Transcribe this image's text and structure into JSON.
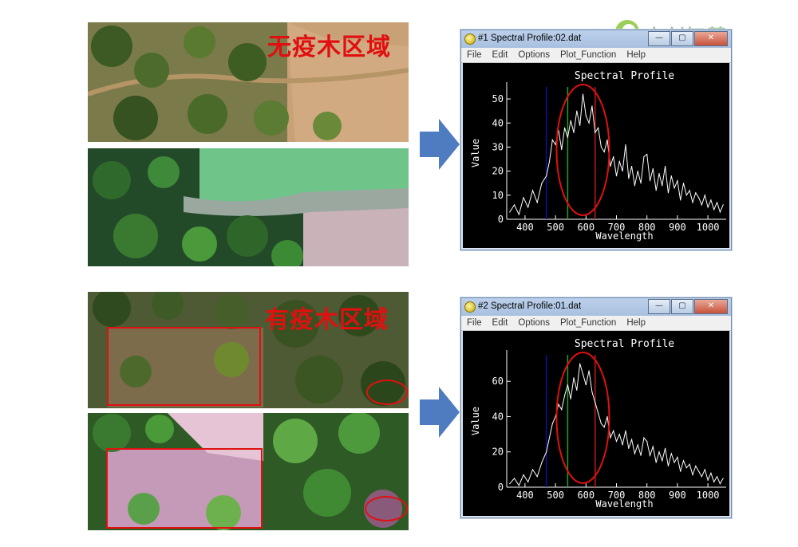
{
  "logo": {
    "text": "高创智慧"
  },
  "top": {
    "region_label": "无疫木区域",
    "window": {
      "title": "#1 Spectral Profile:02.dat",
      "menu": [
        "File",
        "Edit",
        "Options",
        "Plot_Function",
        "Help"
      ],
      "buttons": [
        "—",
        "▢",
        "✕"
      ]
    }
  },
  "bottom": {
    "region_label": "有疫木区域",
    "window": {
      "title": "#2 Spectral Profile:01.dat",
      "menu": [
        "File",
        "Edit",
        "Options",
        "Plot_Function",
        "Help"
      ],
      "buttons": [
        "—",
        "▢",
        "✕"
      ]
    }
  },
  "colors": {
    "annotation_red": "#e01010",
    "arrow_blue": "#4f7cc0",
    "line_blue": "#1010a0",
    "line_green": "#20a020",
    "line_red": "#c01818",
    "series": "#ffffff"
  },
  "chart_data": [
    {
      "type": "line",
      "title": "Spectral Profile",
      "xlabel": "Wavelength",
      "ylabel": "Value",
      "xlim": [
        340,
        1060
      ],
      "ylim": [
        0,
        55
      ],
      "xticks": [
        "400",
        "500",
        "600",
        "700",
        "800",
        "900",
        "1000"
      ],
      "yticks": [
        "0",
        "10",
        "20",
        "30",
        "40",
        "50"
      ],
      "vlines": [
        {
          "x": 470,
          "color": "#1010a0"
        },
        {
          "x": 540,
          "color": "#20a020"
        },
        {
          "x": 630,
          "color": "#c01818"
        }
      ],
      "ellipse_x_center": 590,
      "series": [
        {
          "x": [
            350,
            365,
            380,
            395,
            410,
            425,
            440,
            455,
            470,
            480,
            490,
            500,
            510,
            520,
            530,
            540,
            550,
            560,
            570,
            580,
            590,
            600,
            610,
            620,
            630,
            640,
            650,
            660,
            670,
            680,
            690,
            700,
            710,
            720,
            730,
            740,
            750,
            760,
            770,
            780,
            790,
            800,
            810,
            820,
            830,
            840,
            850,
            860,
            870,
            880,
            890,
            900,
            910,
            920,
            930,
            940,
            950,
            960,
            970,
            980,
            990,
            1000,
            1010,
            1020,
            1030,
            1040,
            1050
          ],
          "y": [
            3,
            6,
            2,
            9,
            5,
            12,
            7,
            15,
            18,
            24,
            33,
            31,
            37,
            29,
            38,
            34,
            41,
            36,
            45,
            39,
            52,
            43,
            40,
            47,
            36,
            38,
            30,
            28,
            33,
            22,
            26,
            18,
            24,
            20,
            31,
            17,
            22,
            14,
            20,
            15,
            26,
            27,
            16,
            21,
            12,
            19,
            14,
            22,
            11,
            18,
            13,
            16,
            8,
            15,
            10,
            12,
            7,
            11,
            9,
            6,
            10,
            5,
            8,
            4,
            7,
            3,
            6
          ]
        }
      ]
    },
    {
      "type": "line",
      "title": "Spectral Profile",
      "xlabel": "Wavelength",
      "ylabel": "Value",
      "xlim": [
        340,
        1060
      ],
      "ylim": [
        0,
        75
      ],
      "xticks": [
        "400",
        "500",
        "600",
        "700",
        "800",
        "900",
        "1000"
      ],
      "yticks": [
        "0",
        "20",
        "40",
        "60"
      ],
      "vlines": [
        {
          "x": 470,
          "color": "#1010a0"
        },
        {
          "x": 540,
          "color": "#20a020"
        },
        {
          "x": 630,
          "color": "#c01818"
        }
      ],
      "ellipse_x_center": 590,
      "series": [
        {
          "x": [
            350,
            365,
            380,
            395,
            410,
            425,
            440,
            455,
            470,
            480,
            490,
            500,
            510,
            520,
            530,
            540,
            550,
            560,
            570,
            580,
            590,
            600,
            610,
            620,
            630,
            640,
            650,
            660,
            670,
            680,
            690,
            700,
            710,
            720,
            730,
            740,
            750,
            760,
            770,
            780,
            790,
            800,
            810,
            820,
            830,
            840,
            850,
            860,
            870,
            880,
            890,
            900,
            910,
            920,
            930,
            940,
            950,
            960,
            970,
            980,
            990,
            1000,
            1010,
            1020,
            1030,
            1040,
            1050
          ],
          "y": [
            2,
            5,
            1,
            7,
            3,
            10,
            6,
            14,
            20,
            28,
            36,
            40,
            47,
            44,
            52,
            58,
            50,
            62,
            55,
            70,
            64,
            58,
            66,
            54,
            48,
            42,
            36,
            34,
            40,
            28,
            32,
            26,
            30,
            24,
            32,
            22,
            27,
            19,
            24,
            18,
            28,
            26,
            18,
            23,
            14,
            20,
            15,
            22,
            12,
            19,
            14,
            17,
            9,
            15,
            11,
            13,
            7,
            12,
            9,
            6,
            10,
            4,
            8,
            3,
            6,
            2,
            5
          ]
        }
      ]
    }
  ]
}
